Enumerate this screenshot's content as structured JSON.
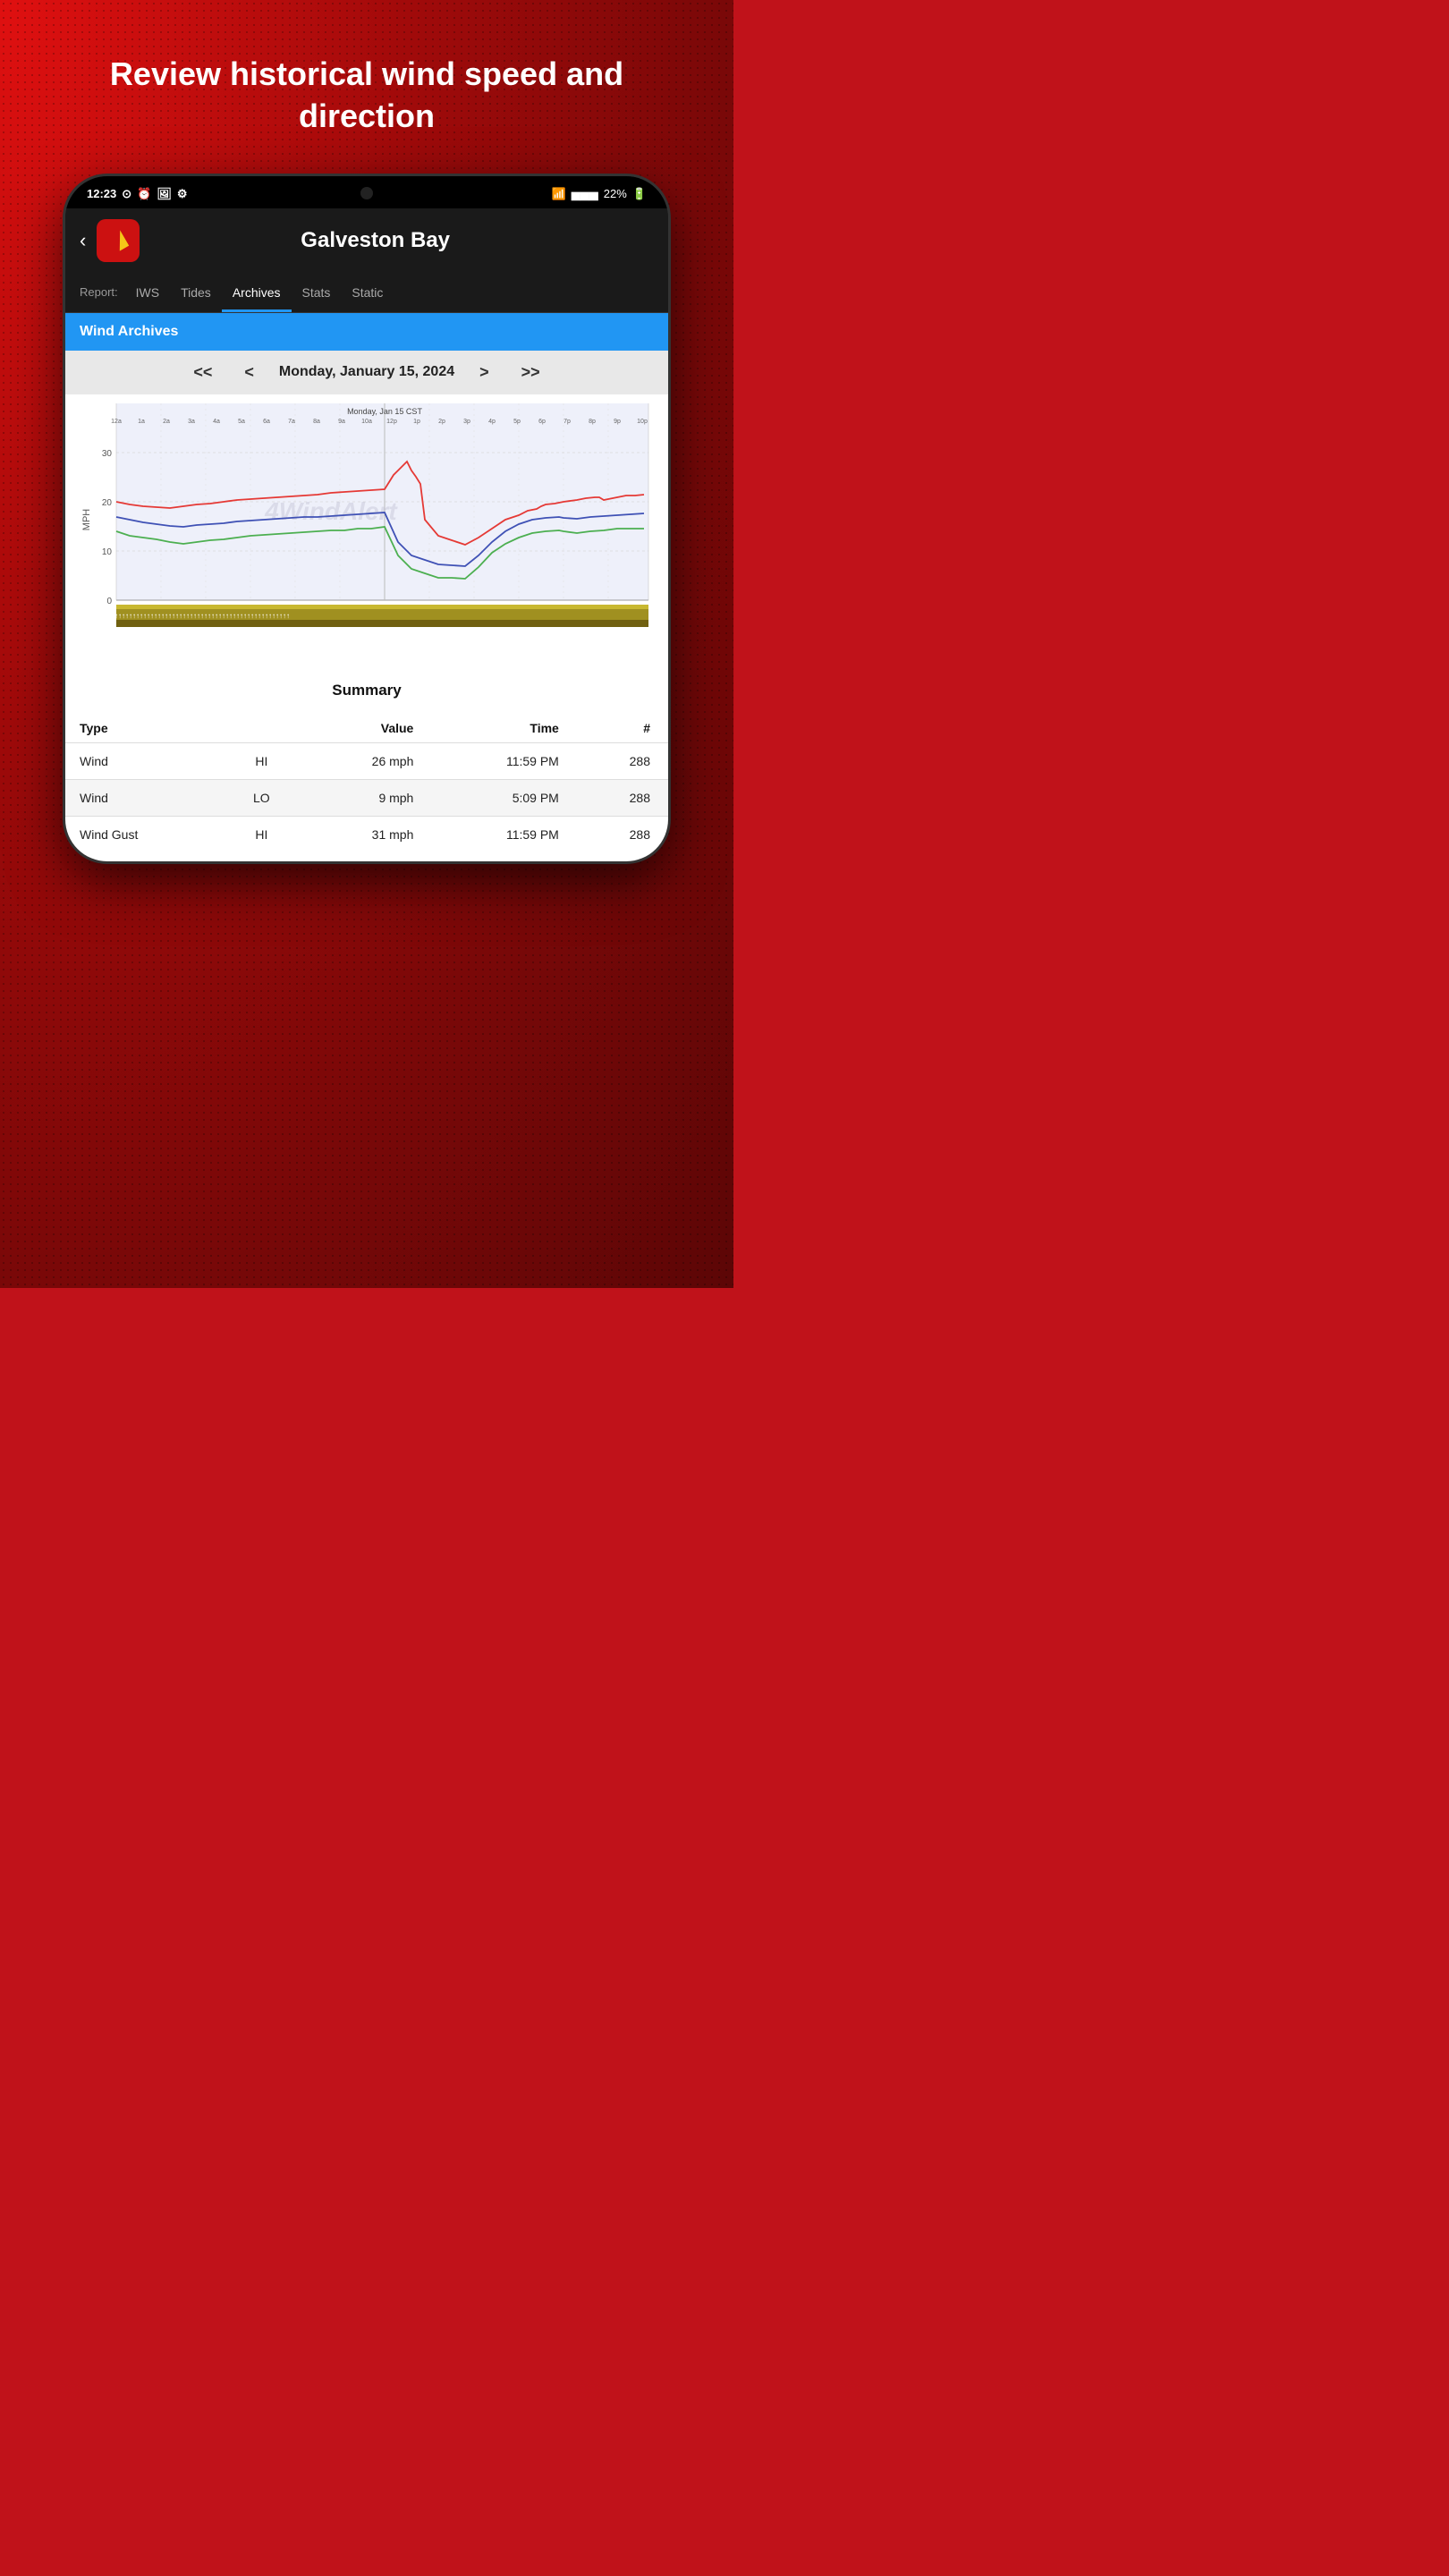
{
  "page": {
    "header_text": "Review historical wind speed and direction"
  },
  "status_bar": {
    "time": "12:23",
    "battery": "22%",
    "icons_left": [
      "navigation-icon",
      "alarm-icon",
      "image-icon",
      "settings-icon"
    ],
    "icons_right": [
      "wifi-icon",
      "signal-icon",
      "battery-icon"
    ]
  },
  "app_header": {
    "back_label": "‹",
    "title": "Galveston Bay"
  },
  "nav": {
    "label": "Report:",
    "tabs": [
      {
        "id": "iws",
        "label": "IWS",
        "active": false
      },
      {
        "id": "tides",
        "label": "Tides",
        "active": false
      },
      {
        "id": "archives",
        "label": "Archives",
        "active": true
      },
      {
        "id": "stats",
        "label": "Stats",
        "active": false
      },
      {
        "id": "static",
        "label": "Static",
        "active": false
      }
    ]
  },
  "section": {
    "title": "Wind Archives"
  },
  "date_nav": {
    "prev_prev": "<<",
    "prev": "<",
    "date": "Monday, January 15, 2024",
    "next": ">",
    "next_next": ">>"
  },
  "chart": {
    "title": "Monday, Jan 15 CST",
    "x_labels": [
      "12a",
      "1a",
      "2a",
      "3a",
      "4a",
      "5a",
      "6a",
      "7a",
      "8a",
      "9a",
      "10a",
      "12p",
      "1p",
      "2p",
      "3p",
      "4p",
      "5p",
      "6p",
      "7p",
      "8p",
      "9p",
      "10p"
    ],
    "y_labels": [
      "0",
      "10",
      "20",
      "30"
    ],
    "watermark": "4WindAlert",
    "y_axis_label": "MPH"
  },
  "summary": {
    "title": "Summary",
    "columns": [
      "Type",
      "",
      "Value",
      "Time",
      "#"
    ],
    "rows": [
      {
        "type": "Wind",
        "subtype": "HI",
        "value": "26 mph",
        "time": "11:59 PM",
        "count": "288"
      },
      {
        "type": "Wind",
        "subtype": "LO",
        "value": "9 mph",
        "time": "5:09 PM",
        "count": "288"
      },
      {
        "type": "Wind Gust",
        "subtype": "HI",
        "value": "31 mph",
        "time": "11:59 PM",
        "count": "288"
      }
    ]
  }
}
